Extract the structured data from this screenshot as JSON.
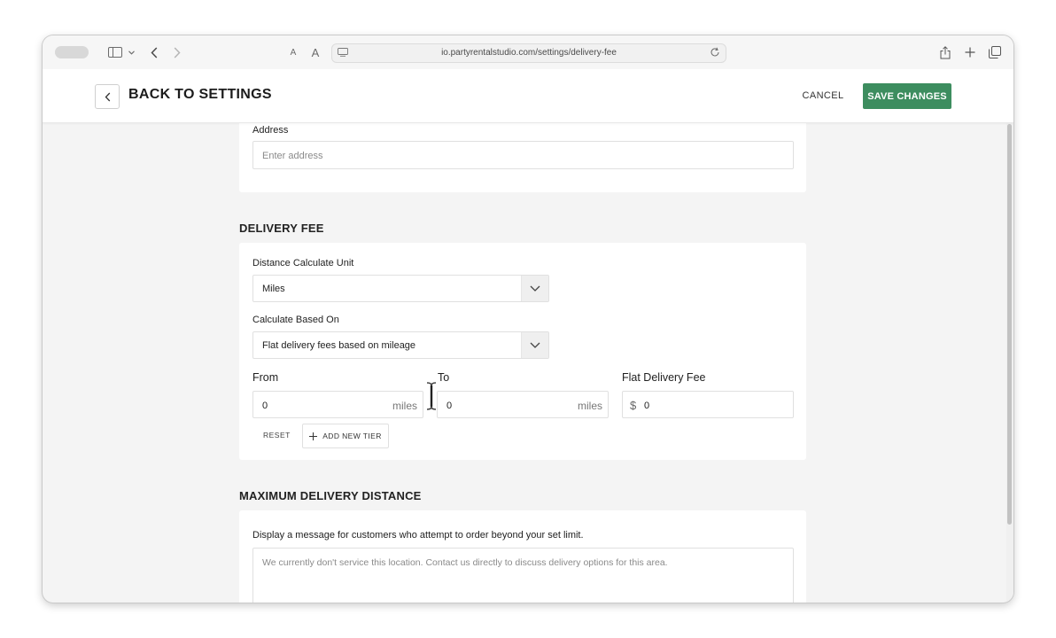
{
  "browser": {
    "url": "io.partyrentalstudio.com/settings/delivery-fee",
    "text_small_label": "A",
    "text_large_label": "A"
  },
  "header": {
    "title": "BACK TO SETTINGS",
    "cancel_label": "CANCEL",
    "save_label": "SAVE CHANGES"
  },
  "address_section": {
    "label": "Address",
    "placeholder": "Enter address"
  },
  "delivery_fee": {
    "title": "DELIVERY FEE",
    "unit_label": "Distance Calculate Unit",
    "unit_value": "Miles",
    "basis_label": "Calculate Based On",
    "basis_value": "Flat delivery fees based on mileage",
    "from_label": "From",
    "to_label": "To",
    "fee_label": "Flat Delivery Fee",
    "from_value": "0",
    "from_unit": "miles",
    "to_value": "0",
    "to_unit": "miles",
    "fee_currency": "$",
    "fee_value": "0",
    "reset_label": "RESET",
    "add_tier_label": "ADD NEW TIER"
  },
  "max_distance": {
    "title": "MAXIMUM DELIVERY DISTANCE",
    "message_label": "Display a message for customers who attempt to order beyond your set limit.",
    "message_placeholder": "We currently don't service this location. Contact us directly to discuss delivery options for this area."
  },
  "colors": {
    "primary_green": "#3d8d5f"
  }
}
